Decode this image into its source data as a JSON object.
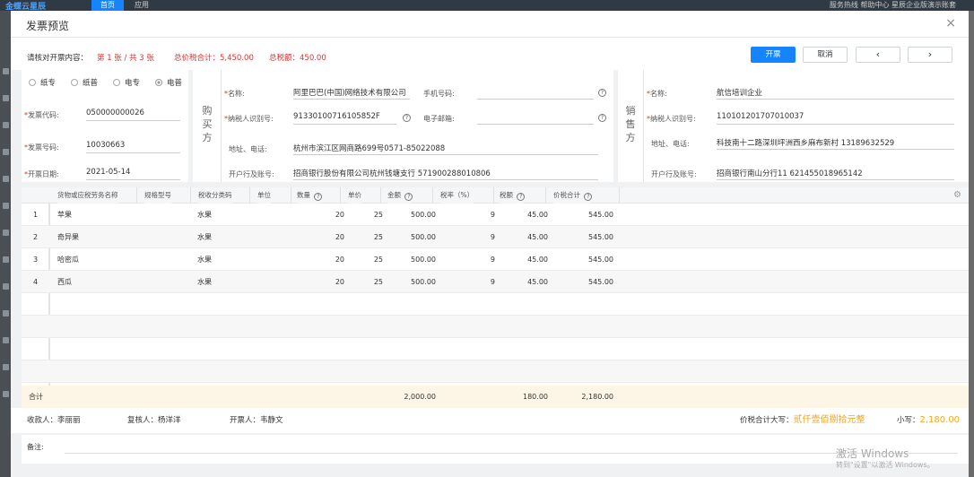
{
  "background": {
    "logo": "金蝶云星辰",
    "tabs": [
      "首页",
      "应用"
    ],
    "right_text": "服务热线  帮助中心  星辰企业版演示账套"
  },
  "modal": {
    "title": "发票预览",
    "close_icon": "×"
  },
  "summary": {
    "label": "请核对开票内容：",
    "page_info": "第 1 张 / 共 3 张",
    "total_with_tax": "总价税合计：5,450.00",
    "total_tax": "总税额：450.00"
  },
  "buttons": {
    "issue": "开票",
    "cancel": "取消",
    "prev": "‹",
    "next": "›"
  },
  "invoice_type": {
    "options": [
      "纸专",
      "纸普",
      "电专",
      "电普"
    ],
    "selected": "电普"
  },
  "invoice_meta": {
    "code_label": "发票代码:",
    "code": "050000000026",
    "number_label": "发票号码:",
    "number": "10030663",
    "date_label": "开票日期:",
    "date": "2021-05-14"
  },
  "buyer": {
    "section_label": "购买方",
    "name_label": "名称:",
    "name": "阿里巴巴(中国)网络技术有限公司",
    "phone_label": "手机号码:",
    "phone": "",
    "tax_id_label": "纳税人识别号:",
    "tax_id": "91330100716105852F",
    "email_label": "电子邮箱:",
    "email": "",
    "address_label": "地址、电话:",
    "address": "杭州市滨江区网商路699号0571-85022088",
    "bank_label": "开户行及账号:",
    "bank": "招商银行股份有限公司杭州钱塘支行 571900288010806"
  },
  "seller": {
    "section_label": "销售方",
    "name_label": "名称:",
    "name": "航信培训企业",
    "tax_id_label": "纳税人识别号:",
    "tax_id": "110101201707010037",
    "address_label": "地址、电话:",
    "address": "科技南十二路深圳坪洲西乡麻布新村 13189632529",
    "bank_label": "开户行及账号:",
    "bank": "招商银行南山分行11 621455018965142"
  },
  "table": {
    "headers": [
      "货物或应税劳务名称",
      "规格型号",
      "税收分类码",
      "单位",
      "数量",
      "单价",
      "金额",
      "税率（%）",
      "税额",
      "价税合计"
    ],
    "rows": [
      {
        "idx": "1",
        "name": "苹果",
        "spec": "",
        "tax_code": "水果",
        "unit": "",
        "qty": "20",
        "price": "25",
        "amount": "500.00",
        "rate": "9",
        "tax": "45.00",
        "total": "545.00"
      },
      {
        "idx": "2",
        "name": "奇异果",
        "spec": "",
        "tax_code": "水果",
        "unit": "",
        "qty": "20",
        "price": "25",
        "amount": "500.00",
        "rate": "9",
        "tax": "45.00",
        "total": "545.00"
      },
      {
        "idx": "3",
        "name": "哈密瓜",
        "spec": "",
        "tax_code": "水果",
        "unit": "",
        "qty": "20",
        "price": "25",
        "amount": "500.00",
        "rate": "9",
        "tax": "45.00",
        "total": "545.00"
      },
      {
        "idx": "4",
        "name": "西瓜",
        "spec": "",
        "tax_code": "水果",
        "unit": "",
        "qty": "20",
        "price": "25",
        "amount": "500.00",
        "rate": "9",
        "tax": "45.00",
        "total": "545.00"
      }
    ],
    "total_label": "合计",
    "total_amount": "2,000.00",
    "total_tax": "180.00",
    "total_sum": "2,180.00"
  },
  "signers": {
    "payee_label": "收款人：",
    "payee": "李丽丽",
    "reviewer_label": "复核人：",
    "reviewer": "杨洋洋",
    "drawer_label": "开票人：",
    "drawer": "韦静文",
    "capital_label": "价税合计大写：",
    "capital": "贰仟壹佰捌拾元整",
    "lower_label": "小写：",
    "lower": "2,180.00"
  },
  "remark": {
    "label": "备注:"
  },
  "watermark": {
    "line1": "激活 Windows",
    "line2": "转到\"设置\"以激活 Windows。"
  },
  "colors": {
    "primary": "#1684fc",
    "red": "#e03030",
    "orange": "#f5a623"
  }
}
